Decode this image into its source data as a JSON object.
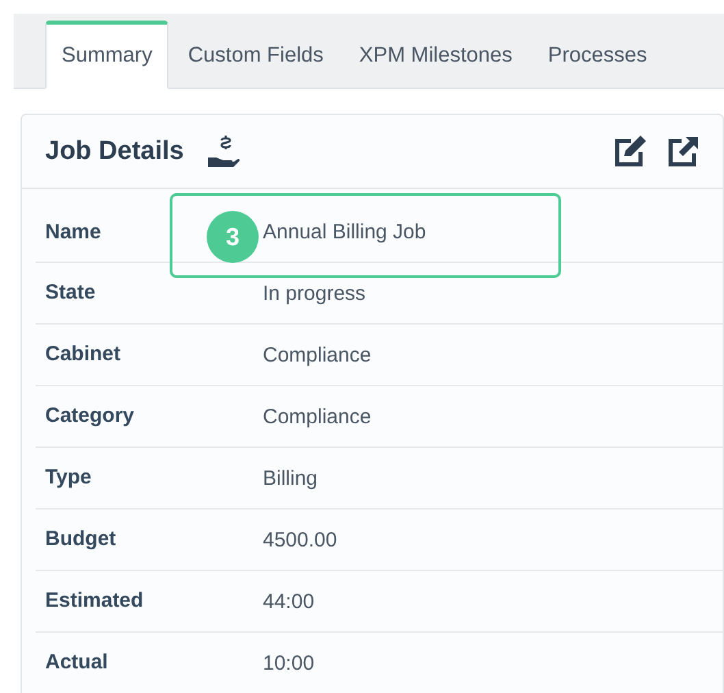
{
  "tabs": [
    {
      "label": "Summary",
      "selected": true
    },
    {
      "label": "Custom Fields",
      "selected": false
    },
    {
      "label": "XPM Milestones",
      "selected": false
    },
    {
      "label": "Processes",
      "selected": false
    }
  ],
  "panel": {
    "title": "Job Details"
  },
  "rows": [
    {
      "label": "Name",
      "value": "Annual Billing Job",
      "highlighted": true,
      "badge": "3"
    },
    {
      "label": "State",
      "value": "In progress",
      "highlighted": false
    },
    {
      "label": "Cabinet",
      "value": "Compliance",
      "highlighted": false
    },
    {
      "label": "Category",
      "value": "Compliance",
      "highlighted": false
    },
    {
      "label": "Type",
      "value": "Billing",
      "highlighted": false
    },
    {
      "label": "Budget",
      "value": "4500.00",
      "highlighted": false
    },
    {
      "label": "Estimated",
      "value": "44:00",
      "highlighted": false
    },
    {
      "label": "Actual",
      "value": "10:00",
      "highlighted": false
    }
  ]
}
